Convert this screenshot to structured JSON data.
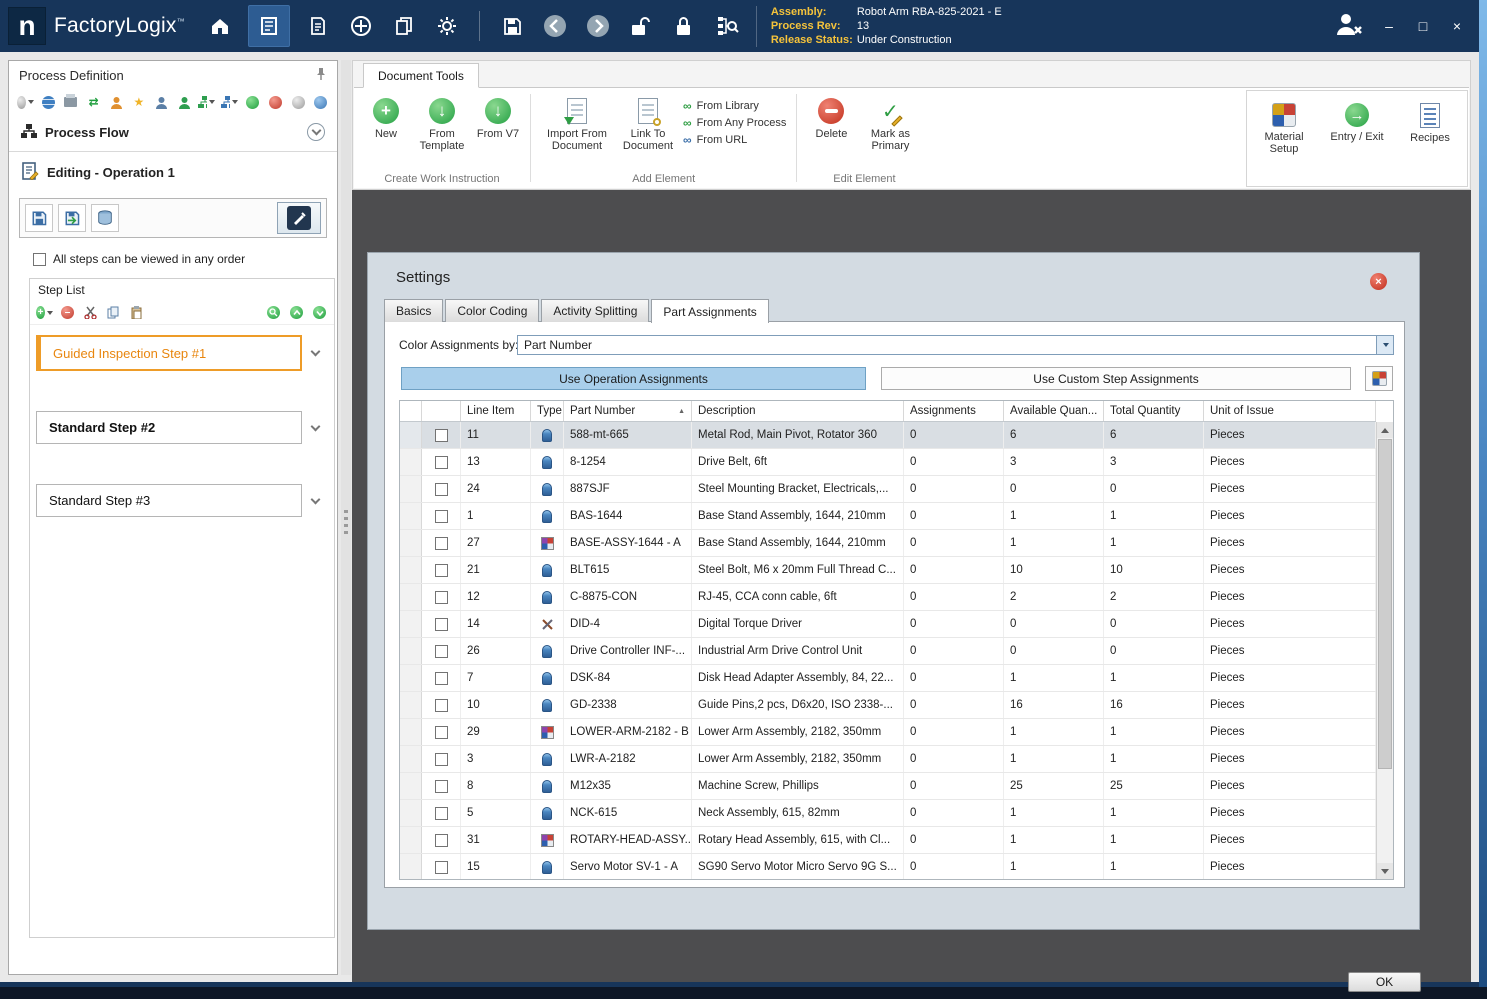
{
  "icons": {
    "plus": "+",
    "minus": "–",
    "down_arrow": "↓",
    "right_arrow": "→",
    "up_small": "^",
    "check": "✓",
    "chain": "∞",
    "star": "★",
    "transfer": "⇄",
    "sort_asc": "▲",
    "dialog_close": "×",
    "trademark": "™",
    "logo_letter": "n"
  },
  "titlebar": {
    "app_name": "FactoryLogix",
    "assembly": {
      "label": "Assembly:",
      "value": "Robot Arm RBA-825-2021 - E"
    },
    "process_rev": {
      "label": "Process Rev:",
      "value": "13"
    },
    "release_status": {
      "label": "Release Status:",
      "value": "Under Construction"
    },
    "window": {
      "minimize": "–",
      "maximize": "□",
      "close": "×"
    }
  },
  "left_panel": {
    "title": "Process Definition",
    "process_flow": "Process Flow",
    "editing": "Editing - Operation 1",
    "order_checkbox": "All steps can be viewed in any order",
    "step_list_title": "Step List",
    "steps": [
      {
        "label": "Guided Inspection Step #1",
        "selected": true,
        "bold": false
      },
      {
        "label": "Standard Step #2",
        "selected": false,
        "bold": true
      },
      {
        "label": "Standard Step #3",
        "selected": false,
        "bold": false
      }
    ]
  },
  "ribbon": {
    "tab": "Document Tools",
    "groups": {
      "create": {
        "label": "Create Work Instruction",
        "items": [
          "New",
          "From Template",
          "From V7"
        ]
      },
      "add": {
        "label": "Add Element",
        "big_items": [
          "Import From Document",
          "Link To Document"
        ],
        "small_items": [
          "From Library",
          "From Any Process",
          "From URL"
        ]
      },
      "edit": {
        "label": "Edit Element",
        "items": [
          "Delete",
          "Mark as Primary"
        ]
      }
    },
    "right_items": [
      "Material Setup",
      "Entry / Exit",
      "Recipes"
    ]
  },
  "dialog": {
    "title": "Settings",
    "tabs": [
      "Basics",
      "Color Coding",
      "Activity Splitting",
      "Part Assignments"
    ],
    "active_tab": "Part Assignments",
    "color_by_label": "Color Assignments by:",
    "color_by_value": "Part Number",
    "buttons": {
      "operation": "Use Operation Assignments",
      "custom": "Use Custom Step Assignments"
    },
    "ok": "OK",
    "table": {
      "columns": [
        "Line Item",
        "Type",
        "Part Number",
        "Description",
        "Assignments",
        "Available Quan...",
        "Total Quantity",
        "Unit of Issue"
      ],
      "sort": {
        "column": "Part Number",
        "direction": "asc"
      },
      "rows": [
        {
          "line": "11",
          "type": "part",
          "part": "588-mt-665",
          "desc": "Metal Rod, Main Pivot, Rotator 360",
          "assignments": "0",
          "available": "6",
          "total": "6",
          "unit": "Pieces",
          "selected": true
        },
        {
          "line": "13",
          "type": "part",
          "part": "8-1254",
          "desc": "Drive Belt, 6ft",
          "assignments": "0",
          "available": "3",
          "total": "3",
          "unit": "Pieces"
        },
        {
          "line": "24",
          "type": "part",
          "part": "887SJF",
          "desc": "Steel Mounting Bracket, Electricals,...",
          "assignments": "0",
          "available": "0",
          "total": "0",
          "unit": "Pieces"
        },
        {
          "line": "1",
          "type": "part",
          "part": "BAS-1644",
          "desc": "Base Stand Assembly, 1644, 210mm",
          "assignments": "0",
          "available": "1",
          "total": "1",
          "unit": "Pieces"
        },
        {
          "line": "27",
          "type": "assembly",
          "part": "BASE-ASSY-1644 - A",
          "desc": "Base Stand Assembly, 1644, 210mm",
          "assignments": "0",
          "available": "1",
          "total": "1",
          "unit": "Pieces"
        },
        {
          "line": "21",
          "type": "part",
          "part": "BLT615",
          "desc": "Steel Bolt, M6 x 20mm Full Thread C...",
          "assignments": "0",
          "available": "10",
          "total": "10",
          "unit": "Pieces"
        },
        {
          "line": "12",
          "type": "part",
          "part": "C-8875-CON",
          "desc": "RJ-45, CCA conn cable, 6ft",
          "assignments": "0",
          "available": "2",
          "total": "2",
          "unit": "Pieces"
        },
        {
          "line": "14",
          "type": "tool",
          "part": "DID-4",
          "desc": "Digital Torque Driver",
          "assignments": "0",
          "available": "0",
          "total": "0",
          "unit": "Pieces"
        },
        {
          "line": "26",
          "type": "part",
          "part": "Drive Controller INF-...",
          "desc": "Industrial Arm Drive Control Unit",
          "assignments": "0",
          "available": "0",
          "total": "0",
          "unit": "Pieces"
        },
        {
          "line": "7",
          "type": "part",
          "part": "DSK-84",
          "desc": "Disk Head Adapter Assembly, 84, 22...",
          "assignments": "0",
          "available": "1",
          "total": "1",
          "unit": "Pieces"
        },
        {
          "line": "10",
          "type": "part",
          "part": "GD-2338",
          "desc": "Guide Pins,2 pcs, D6x20, ISO 2338-...",
          "assignments": "0",
          "available": "16",
          "total": "16",
          "unit": "Pieces"
        },
        {
          "line": "29",
          "type": "assembly",
          "part": "LOWER-ARM-2182 - B",
          "desc": "Lower Arm Assembly, 2182, 350mm",
          "assignments": "0",
          "available": "1",
          "total": "1",
          "unit": "Pieces"
        },
        {
          "line": "3",
          "type": "part",
          "part": "LWR-A-2182",
          "desc": "Lower Arm Assembly, 2182, 350mm",
          "assignments": "0",
          "available": "1",
          "total": "1",
          "unit": "Pieces"
        },
        {
          "line": "8",
          "type": "part",
          "part": "M12x35",
          "desc": "Machine Screw, Phillips",
          "assignments": "0",
          "available": "25",
          "total": "25",
          "unit": "Pieces"
        },
        {
          "line": "5",
          "type": "part",
          "part": "NCK-615",
          "desc": "Neck Assembly, 615, 82mm",
          "assignments": "0",
          "available": "1",
          "total": "1",
          "unit": "Pieces"
        },
        {
          "line": "31",
          "type": "assembly",
          "part": "ROTARY-HEAD-ASSY...",
          "desc": "Rotary Head Assembly, 615, with Cl...",
          "assignments": "0",
          "available": "1",
          "total": "1",
          "unit": "Pieces"
        },
        {
          "line": "15",
          "type": "part",
          "part": "Servo Motor SV-1 - A",
          "desc": "SG90 Servo Motor Micro Servo 9G S...",
          "assignments": "0",
          "available": "1",
          "total": "1",
          "unit": "Pieces"
        }
      ]
    }
  }
}
